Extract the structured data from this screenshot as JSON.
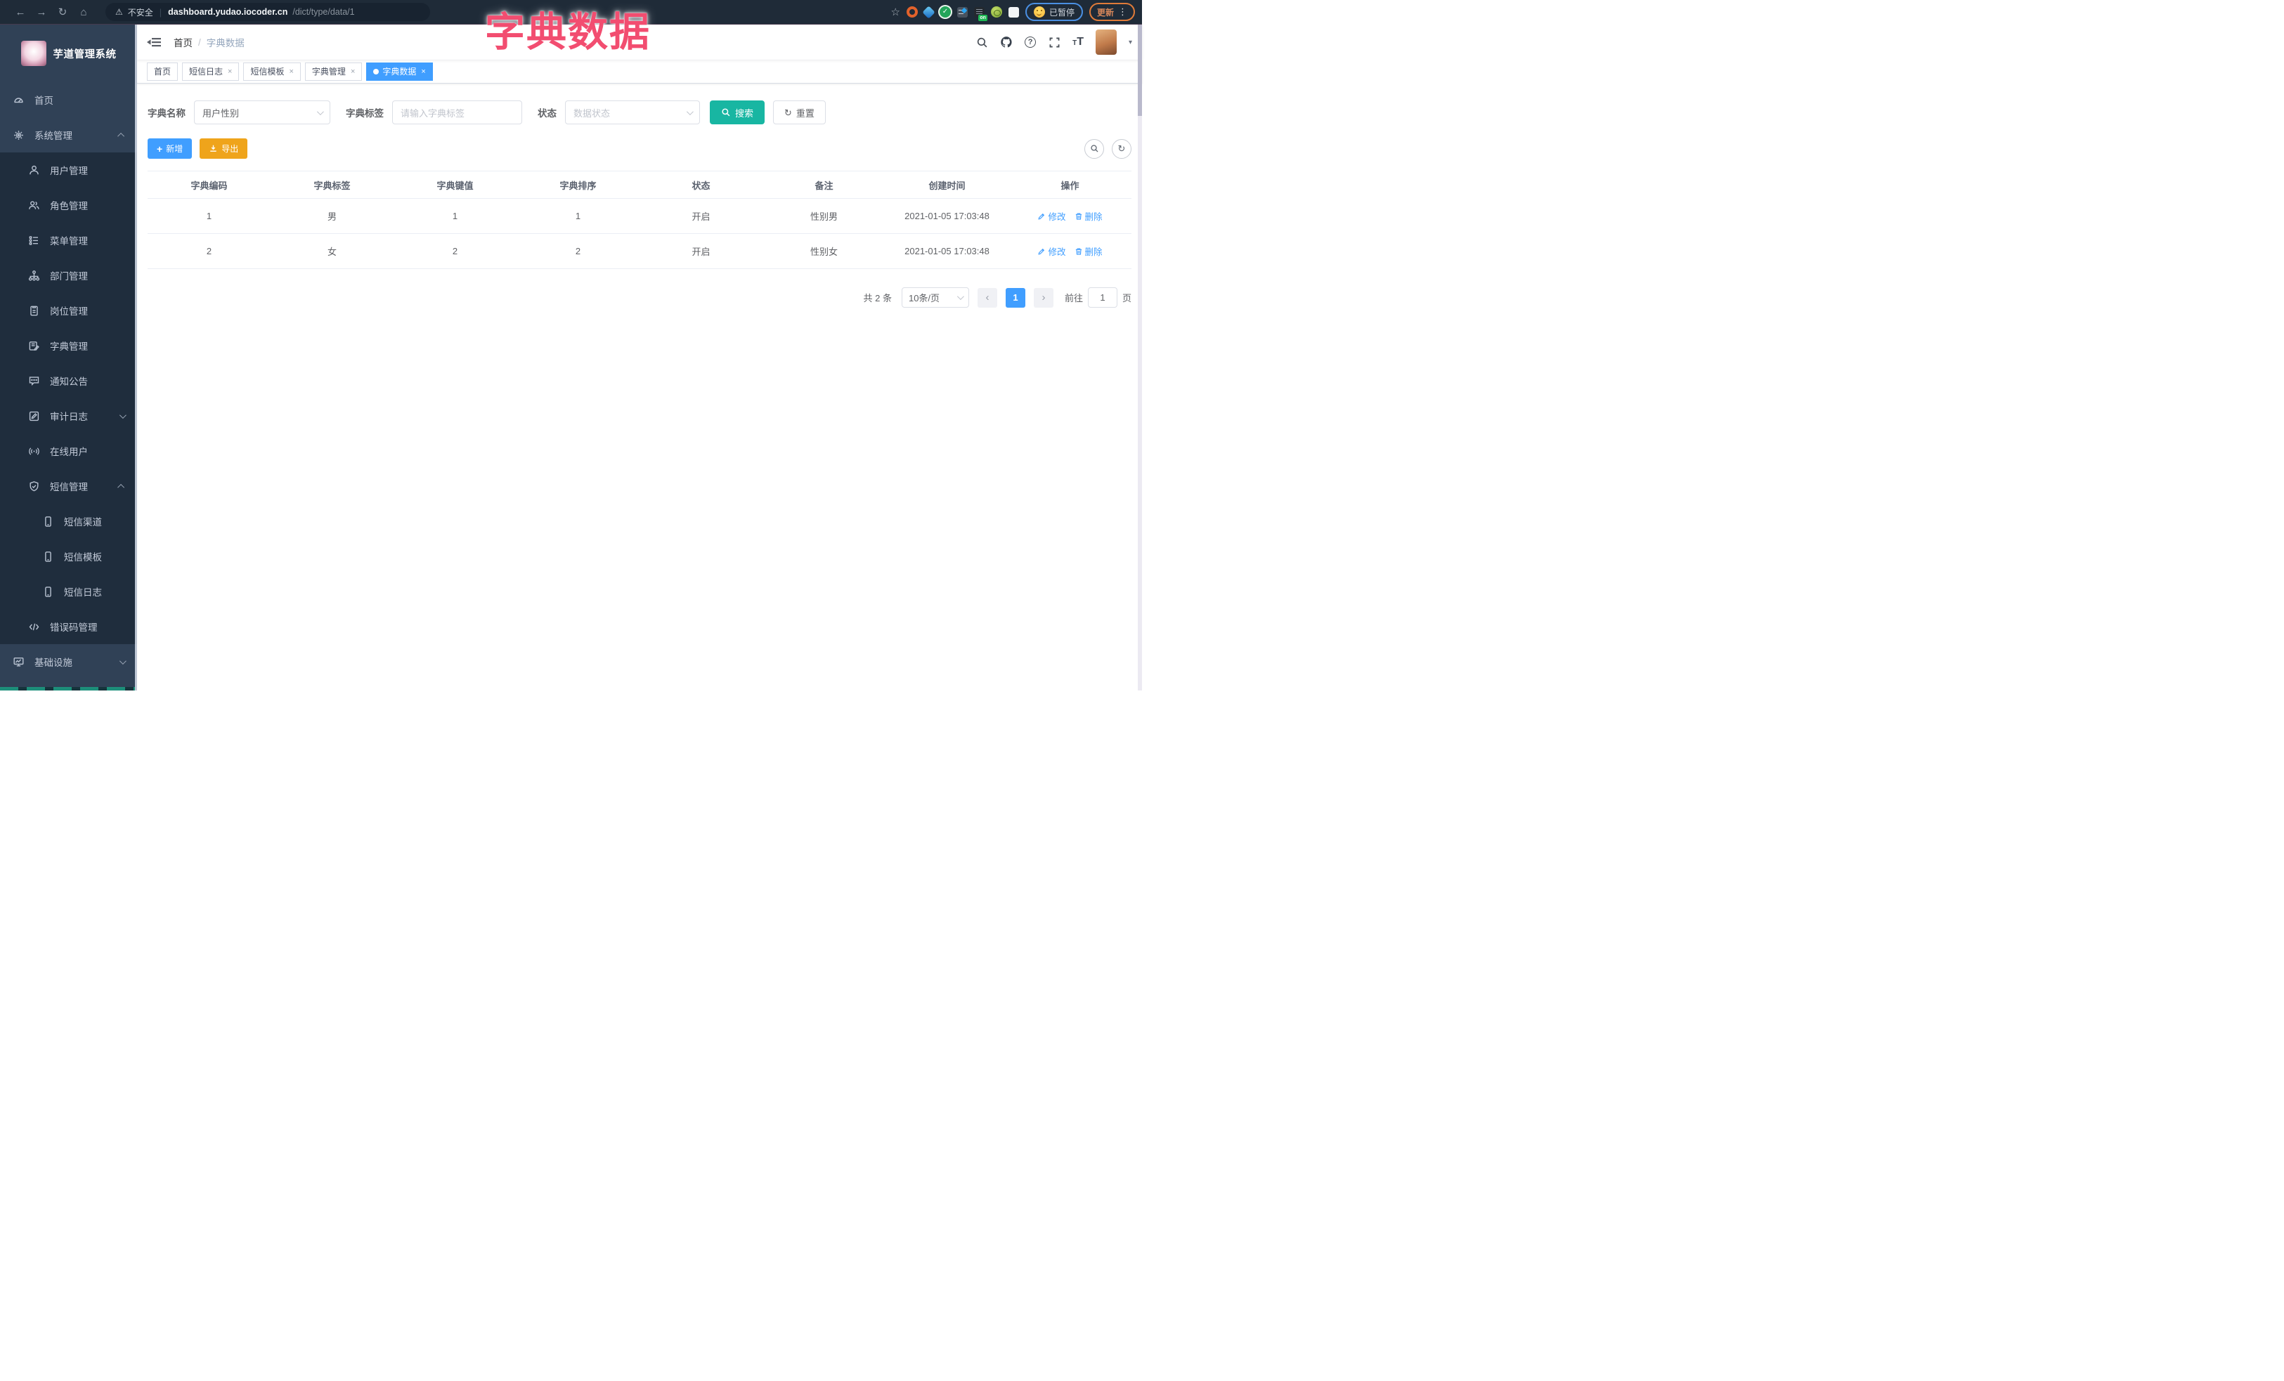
{
  "ui": {
    "back": "←",
    "forward": "→",
    "reload": "↻",
    "home": "⌂",
    "warning": "⚠",
    "star": "☆",
    "check": "✓",
    "dots": "⋮",
    "close": "×",
    "help": "?",
    "pager_prev": "‹",
    "pager_next": "›",
    "font_small": "T",
    "font_large": "T",
    "refresh": "↻",
    "plus": "+",
    "caret": "▾"
  },
  "browser": {
    "security_label": "不安全",
    "url_host": "dashboard.yudao.iocoder.cn",
    "url_path": "/dict/type/data/1",
    "extension_badge": "on",
    "profile_status": "已暂停",
    "update_label": "更新"
  },
  "watermark": "字典数据",
  "sidebar": {
    "logo_title": "芋道管理系统",
    "items": [
      {
        "label": "首页"
      },
      {
        "label": "系统管理"
      },
      {
        "label": "用户管理"
      },
      {
        "label": "角色管理"
      },
      {
        "label": "菜单管理"
      },
      {
        "label": "部门管理"
      },
      {
        "label": "岗位管理"
      },
      {
        "label": "字典管理"
      },
      {
        "label": "通知公告"
      },
      {
        "label": "审计日志"
      },
      {
        "label": "在线用户"
      },
      {
        "label": "短信管理"
      },
      {
        "label": "短信渠道"
      },
      {
        "label": "短信模板"
      },
      {
        "label": "短信日志"
      },
      {
        "label": "错误码管理"
      },
      {
        "label": "基础设施"
      }
    ]
  },
  "navbar": {
    "breadcrumb_home": "首页",
    "breadcrumb_sep": "/",
    "breadcrumb_current": "字典数据"
  },
  "tabs": [
    {
      "label": "首页"
    },
    {
      "label": "短信日志"
    },
    {
      "label": "短信模板"
    },
    {
      "label": "字典管理"
    },
    {
      "label": "字典数据"
    }
  ],
  "filters": {
    "dict_name_label": "字典名称",
    "dict_name_value": "用户性别",
    "dict_label_label": "字典标签",
    "dict_label_placeholder": "请输入字典标签",
    "status_label": "状态",
    "status_placeholder": "数据状态",
    "search_label": "搜索",
    "reset_label": "重置"
  },
  "toolbar": {
    "add_label": "新增",
    "export_label": "导出"
  },
  "table": {
    "headers": [
      "字典编码",
      "字典标签",
      "字典键值",
      "字典排序",
      "状态",
      "备注",
      "创建时间",
      "操作"
    ],
    "rows": [
      {
        "code": "1",
        "label": "男",
        "value": "1",
        "sort": "1",
        "status": "开启",
        "remark": "性别男",
        "created": "2021-01-05 17:03:48"
      },
      {
        "code": "2",
        "label": "女",
        "value": "2",
        "sort": "2",
        "status": "开启",
        "remark": "性别女",
        "created": "2021-01-05 17:03:48"
      }
    ],
    "edit_label": "修改",
    "delete_label": "删除"
  },
  "pagination": {
    "total": "共 2 条",
    "page_size": "10条/页",
    "page": "1",
    "goto_label": "前往",
    "goto_value": "1",
    "goto_unit": "页"
  },
  "colors": {
    "primary": "#409eff",
    "search_button": "#18b6a2",
    "export_button": "#efa41b",
    "watermark": "#f24d70",
    "sidebar_bg": "#304156",
    "submenu_bg": "#1f2d3d",
    "chrome_bg": "#1f2b38"
  }
}
